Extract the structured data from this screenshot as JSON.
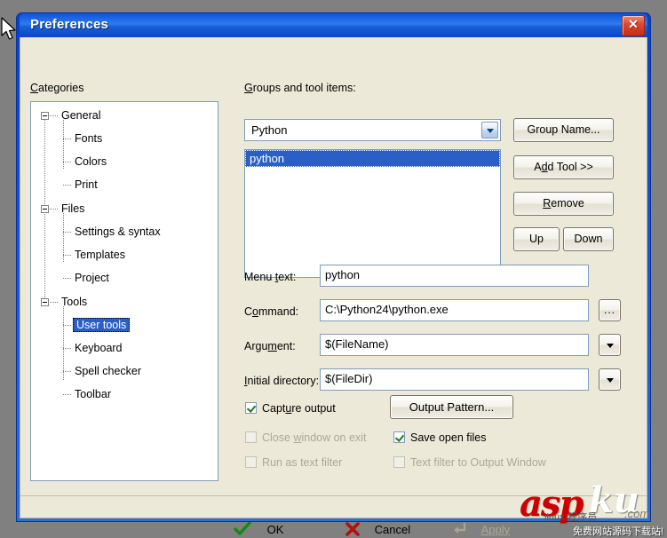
{
  "window": {
    "title": "Preferences",
    "close_label": "Close",
    "titlebar_color": "#1a5fd8",
    "client_color": "#ece9d8"
  },
  "categories": {
    "label": "Categories",
    "label_accel": "C",
    "selected": "User tools",
    "nodes": [
      {
        "text": "General",
        "level": 0,
        "expander": "minus"
      },
      {
        "text": "Fonts",
        "level": 1,
        "expander": "none"
      },
      {
        "text": "Colors",
        "level": 1,
        "expander": "none"
      },
      {
        "text": "Print",
        "level": 1,
        "expander": "none"
      },
      {
        "text": "Files",
        "level": 0,
        "expander": "minus"
      },
      {
        "text": "Settings & syntax",
        "level": 1,
        "expander": "none"
      },
      {
        "text": "Templates",
        "level": 1,
        "expander": "none"
      },
      {
        "text": "Project",
        "level": 1,
        "expander": "none"
      },
      {
        "text": "Tools",
        "level": 0,
        "expander": "minus"
      },
      {
        "text": "User tools",
        "level": 1,
        "expander": "none"
      },
      {
        "text": "Keyboard",
        "level": 1,
        "expander": "none"
      },
      {
        "text": "Spell checker",
        "level": 1,
        "expander": "none"
      },
      {
        "text": "Toolbar",
        "level": 1,
        "expander": "none"
      }
    ]
  },
  "groups": {
    "label": "Groups and tool items:",
    "label_accel": "G",
    "combo_value": "Python",
    "items": [
      "python"
    ],
    "selected_item": "python"
  },
  "side_buttons": {
    "group_name": "Group Name...",
    "add_tool": "Add Tool >>",
    "add_tool_accel": "d",
    "remove": "Remove",
    "remove_accel": "R",
    "up": "Up",
    "down": "Down"
  },
  "fields": [
    {
      "label": "Menu text:",
      "accel": "t",
      "value": "python",
      "button": "none"
    },
    {
      "label": "Command:",
      "accel": "o",
      "value": "C:\\Python24\\python.exe",
      "button": "browse"
    },
    {
      "label": "Argument:",
      "accel": "m",
      "value": "$(FileName)",
      "button": "dropdown"
    },
    {
      "label": "Initial directory:",
      "accel": "I",
      "value": "$(FileDir)",
      "button": "dropdown"
    }
  ],
  "options": {
    "capture_output": {
      "label": "Capture output",
      "accel": "u",
      "checked": true,
      "enabled": true
    },
    "close_window_on_exit": {
      "label": "Close window on exit",
      "accel": "w",
      "checked": false,
      "enabled": false
    },
    "run_as_text_filter": {
      "label": "Run as text filter",
      "accel": "",
      "checked": false,
      "enabled": false
    },
    "save_open_files": {
      "label": "Save open files",
      "accel": "",
      "checked": true,
      "enabled": true
    },
    "text_filter_to_output_window": {
      "label": "Text filter to Output Window",
      "accel": "",
      "checked": false,
      "enabled": false
    },
    "output_pattern_button": "Output Pattern..."
  },
  "footer": {
    "ok": "OK",
    "cancel": "Cancel",
    "apply": "Apply",
    "apply_enabled": false
  },
  "watermark": {
    "asp": "asp",
    "ku": "ku",
    "com": ".com",
    "chinese": "免费网站源码下载站!",
    "small": "linux·程序员"
  }
}
